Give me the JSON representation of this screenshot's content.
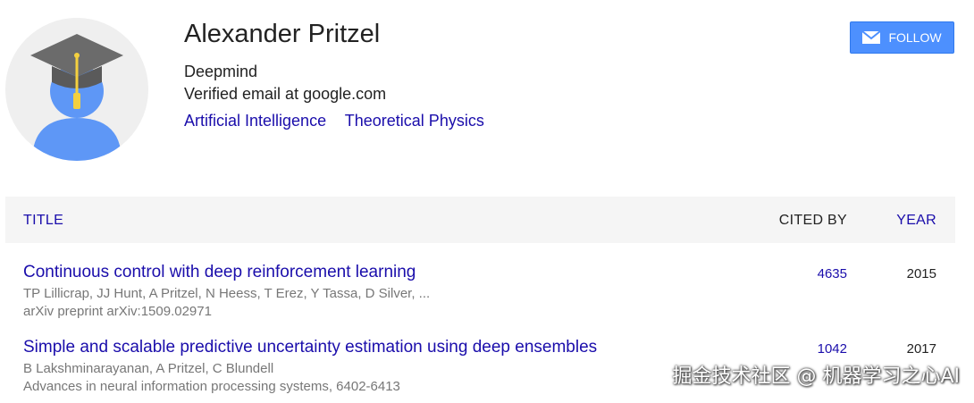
{
  "profile": {
    "name": "Alexander Pritzel",
    "affiliation": "Deepmind",
    "email": "Verified email at google.com",
    "interests": [
      "Artificial Intelligence",
      "Theoretical Physics"
    ],
    "avatar_icon": "graduate-avatar-icon"
  },
  "follow": {
    "label": "FOLLOW",
    "icon": "envelope-icon"
  },
  "table": {
    "headers": {
      "title": "TITLE",
      "cited_by": "CITED BY",
      "year": "YEAR"
    },
    "rows": [
      {
        "title": "Continuous control with deep reinforcement learning",
        "authors": "TP Lillicrap, JJ Hunt, A Pritzel, N Heess, T Erez, Y Tassa, D Silver, ...",
        "venue": "arXiv preprint arXiv:1509.02971",
        "cited_by": "4635",
        "year": "2015"
      },
      {
        "title": "Simple and scalable predictive uncertainty estimation using deep ensembles",
        "authors": "B Lakshminarayanan, A Pritzel, C Blundell",
        "venue": "Advances in neural information processing systems, 6402-6413",
        "cited_by": "1042",
        "year": "2017"
      }
    ]
  },
  "watermark": "掘金技术社区 @ 机器学习之心AI",
  "colors": {
    "link": "#1a0dab",
    "button": "#4d90fe",
    "avatar_body": "#5e97f6",
    "cap": "#757575",
    "tassel": "#f4d03f"
  }
}
